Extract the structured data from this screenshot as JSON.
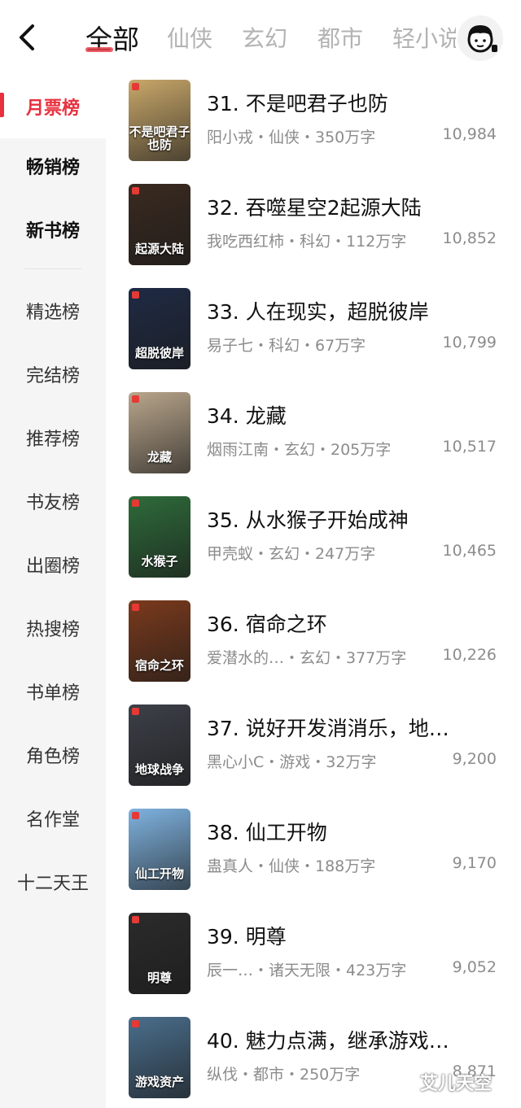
{
  "header": {
    "back_icon": "back-arrow-icon",
    "tabs": [
      {
        "label": "全部"
      },
      {
        "label": "仙侠"
      },
      {
        "label": "玄幻"
      },
      {
        "label": "都市"
      },
      {
        "label": "轻小说"
      }
    ],
    "avatar_icon": "user-avatar-icon",
    "accent_color": "#e8303e"
  },
  "sidebar": {
    "items": [
      {
        "label": "月票榜"
      },
      {
        "label": "畅销榜"
      },
      {
        "label": "新书榜"
      },
      {
        "label": "精选榜"
      },
      {
        "label": "完结榜"
      },
      {
        "label": "推荐榜"
      },
      {
        "label": "书友榜"
      },
      {
        "label": "出圈榜"
      },
      {
        "label": "热搜榜"
      },
      {
        "label": "书单榜"
      },
      {
        "label": "角色榜"
      },
      {
        "label": "名作堂"
      },
      {
        "label": "十二天王"
      }
    ]
  },
  "books": [
    {
      "title": "31. 不是吧君子也防",
      "meta": "阳小戎・仙侠・350万字",
      "count": "10,984",
      "cover_text": "不是吧君子也防",
      "cover_color": "#c9a86a"
    },
    {
      "title": "32. 吞噬星空2起源大陆",
      "meta": "我吃西红柿・科幻・112万字",
      "count": "10,852",
      "cover_text": "起源大陆",
      "cover_color": "#3a2a20"
    },
    {
      "title": "33. 人在现实，超脱彼岸",
      "meta": "易子七・科幻・67万字",
      "count": "10,799",
      "cover_text": "超脱彼岸",
      "cover_color": "#1f2a44"
    },
    {
      "title": "34. 龙藏",
      "meta": "烟雨江南・玄幻・205万字",
      "count": "10,517",
      "cover_text": "龙藏",
      "cover_color": "#b9a68c"
    },
    {
      "title": "35. 从水猴子开始成神",
      "meta": "甲壳蚁・玄幻・247万字",
      "count": "10,465",
      "cover_text": "水猴子",
      "cover_color": "#2e6b3a"
    },
    {
      "title": "36. 宿命之环",
      "meta": "爱潜水的…・玄幻・377万字",
      "count": "10,226",
      "cover_text": "宿命之环",
      "cover_color": "#7a3a1c"
    },
    {
      "title": "37. 说好开发消消乐，地…",
      "meta": "黑心小C・游戏・32万字",
      "count": "9,200",
      "cover_text": "地球战争",
      "cover_color": "#3c4048"
    },
    {
      "title": "38. 仙工开物",
      "meta": "蛊真人・仙侠・188万字",
      "count": "9,170",
      "cover_text": "仙工开物",
      "cover_color": "#7fb3e0"
    },
    {
      "title": "39. 明尊",
      "meta": "辰一…・诸天无限・423万字",
      "count": "9,052",
      "cover_text": "明尊",
      "cover_color": "#2b2b2b"
    },
    {
      "title": "40. 魅力点满，继承游戏…",
      "meta": "纵伐・都市・250万字",
      "count": "8,871",
      "cover_text": "游戏资产",
      "cover_color": "#4a6e8c"
    }
  ],
  "watermark": "艾儿天空"
}
